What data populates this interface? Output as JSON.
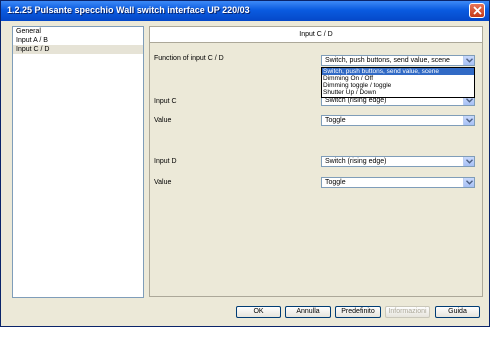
{
  "window": {
    "title": "1.2.25 Pulsante specchio Wall switch interface UP 220/03"
  },
  "tree": {
    "items": [
      {
        "label": "General"
      },
      {
        "label": "Input A / B"
      },
      {
        "label": "Input C / D"
      }
    ]
  },
  "panel": {
    "header": "Input C / D",
    "rows": {
      "function": {
        "label": "Function of input C / D",
        "value": "Switch, push buttons, send value, scene"
      },
      "input_c": {
        "label": "Input C",
        "value": "Switch (rising edge)"
      },
      "value_c": {
        "label": "Value",
        "value": "Toggle"
      },
      "input_d": {
        "label": "Input D",
        "value": "Switch (rising edge)"
      },
      "value_d": {
        "label": "Value",
        "value": "Toggle"
      }
    },
    "dropdown_options": [
      "Switch, push buttons, send value, scene",
      "Dimming On / Off",
      "Dimming toggle / toggle",
      "Shutter Up / Down"
    ]
  },
  "buttons": {
    "ok": "OK",
    "cancel": "Annulla",
    "default": "Predefinito",
    "info": "Informazioni",
    "help": "Guida"
  },
  "colors": {
    "titlebar": "#0a5be0",
    "selection": "#316ac5",
    "window_bg": "#ece9d8"
  }
}
